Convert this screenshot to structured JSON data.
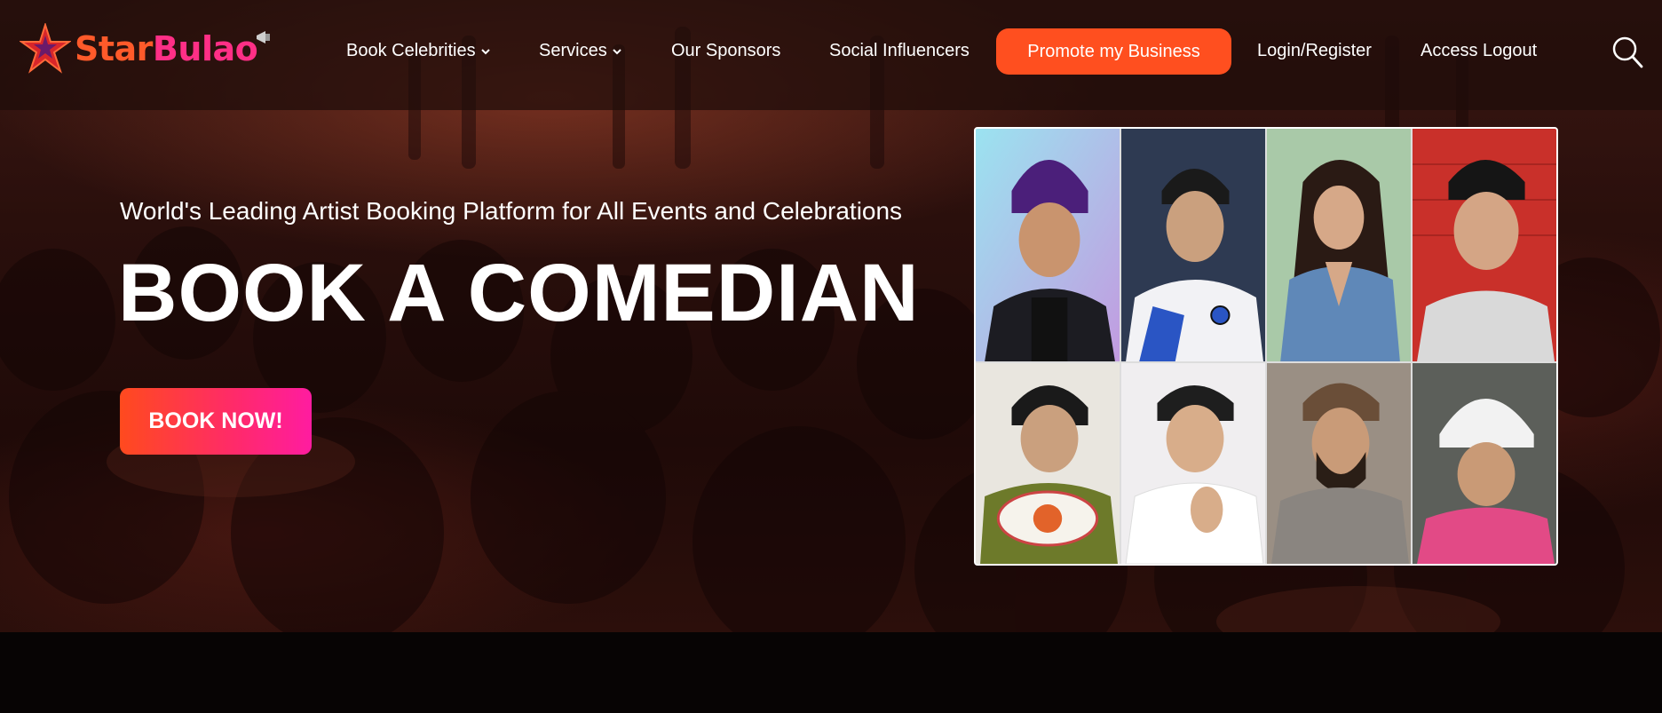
{
  "brand": {
    "name_part1": "Star",
    "name_part2": "Bulao"
  },
  "nav": {
    "items": [
      {
        "label": "Book Celebrities",
        "has_dropdown": true
      },
      {
        "label": "Services",
        "has_dropdown": true
      },
      {
        "label": "Our Sponsors",
        "has_dropdown": false
      },
      {
        "label": "Social Influencers",
        "has_dropdown": false
      }
    ],
    "promote_label": "Promote my Business",
    "login_label": "Login/Register",
    "logout_label": "Access Logout",
    "search_icon": "search-icon"
  },
  "hero": {
    "tagline": "World's Leading Artist Booking Platform for All Events and Celebrations",
    "headline": "BOOK A COMEDIAN",
    "cta_label": "BOOK NOW!"
  },
  "gallery": {
    "photos": [
      {
        "name": "celebrity-photo-1",
        "bg": "#8fd3e8",
        "accent": "#4b1f7a"
      },
      {
        "name": "celebrity-photo-2",
        "bg": "#2e3a52",
        "accent": "#2a55c4"
      },
      {
        "name": "celebrity-photo-3",
        "bg": "#a9c9a8",
        "accent": "#5f88b8"
      },
      {
        "name": "celebrity-photo-4",
        "bg": "#c9302a",
        "accent": "#d9d9d9"
      },
      {
        "name": "celebrity-photo-5",
        "bg": "#e9e6df",
        "accent": "#6d7a2a"
      },
      {
        "name": "celebrity-photo-6",
        "bg": "#f0eef0",
        "accent": "#ffffff"
      },
      {
        "name": "celebrity-photo-7",
        "bg": "#9a8f84",
        "accent": "#8a8580"
      },
      {
        "name": "celebrity-photo-8",
        "bg": "#5c5f5a",
        "accent": "#e24a86"
      }
    ]
  },
  "colors": {
    "accent_orange": "#ff4f1f",
    "accent_pink": "#ff1ca0",
    "logo_orange": "#ff5a2a",
    "logo_pink": "#ff2f86"
  }
}
